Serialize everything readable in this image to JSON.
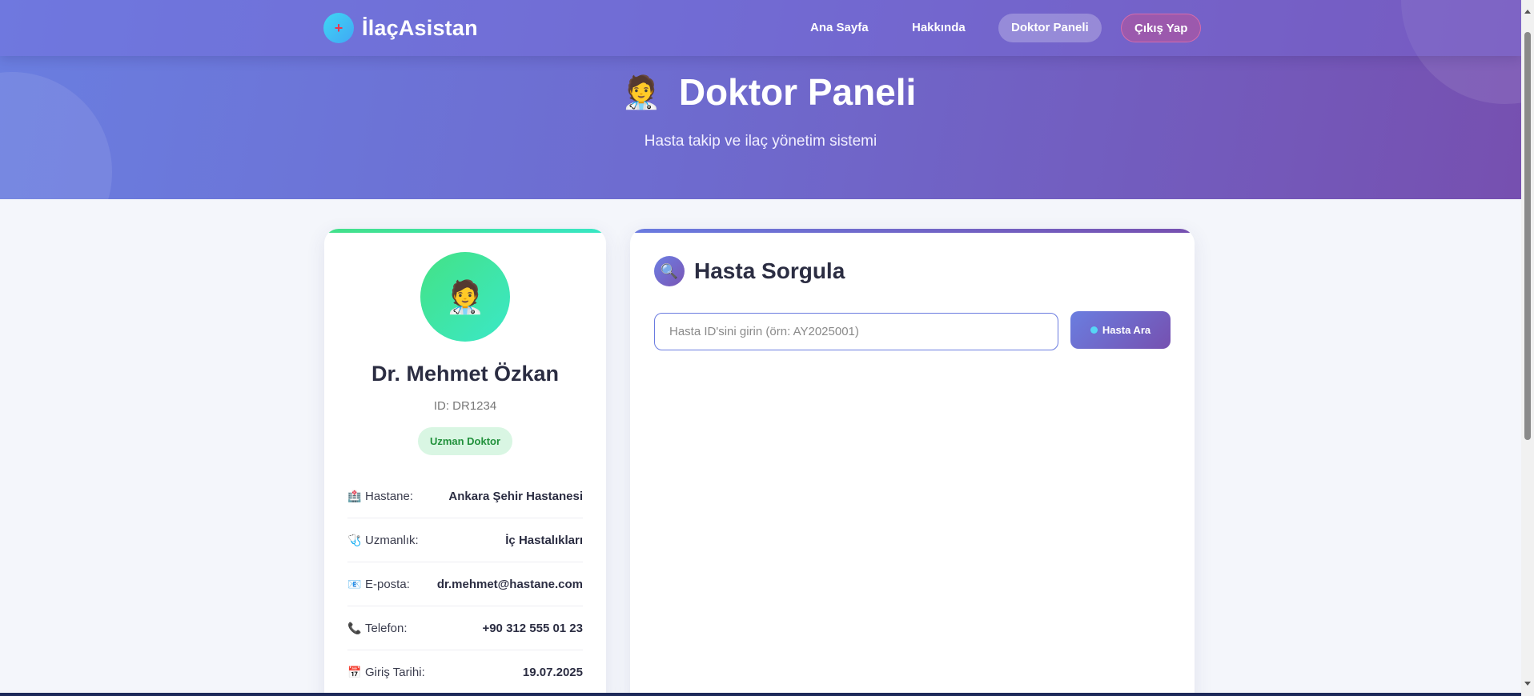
{
  "brand": {
    "name": "İlaçAsistan",
    "logo_icon": "plus-icon"
  },
  "nav": {
    "home": "Ana Sayfa",
    "about": "Hakkında",
    "panel": "Doktor Paneli",
    "logout": "Çıkış Yap"
  },
  "hero": {
    "emoji": "🧑‍⚕️",
    "title": "Doktor Paneli",
    "subtitle": "Hasta takip ve ilaç yönetim sistemi"
  },
  "profile": {
    "avatar": "🧑‍⚕️",
    "name": "Dr. Mehmet Özkan",
    "id": "ID: DR1234",
    "badge": "Uzman Doktor",
    "info": [
      {
        "icon": "🏥",
        "label": "Hastane:",
        "value": "Ankara Şehir Hastanesi"
      },
      {
        "icon": "🩺",
        "label": "Uzmanlık:",
        "value": "İç Hastalıkları"
      },
      {
        "icon": "📧",
        "label": "E-posta:",
        "value": "dr.mehmet@hastane.com"
      },
      {
        "icon": "📞",
        "label": "Telefon:",
        "value": "+90 312 555 01 23"
      },
      {
        "icon": "📅",
        "label": "Giriş Tarihi:",
        "value": "19.07.2025"
      }
    ]
  },
  "search": {
    "icon": "🔍",
    "title": "Hasta Sorgula",
    "placeholder": "Hasta ID'sini girin (örn: AY2025001)",
    "value": "",
    "button": "Hasta Ara"
  },
  "colors": {
    "accent": "#6a7be0",
    "accent2": "#7650b0",
    "green": "#43e089",
    "badge_text": "#22913c"
  }
}
